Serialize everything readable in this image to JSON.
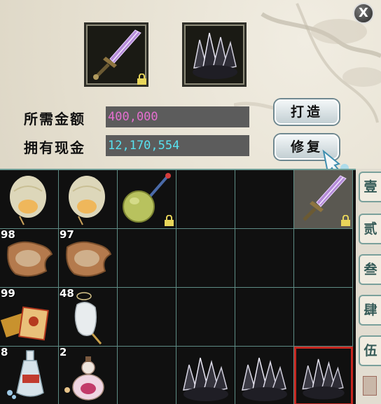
{
  "window": {
    "close_label": "X"
  },
  "forge": {
    "required_label": "所需金额",
    "required_value": "400,000",
    "owned_label": "拥有现金",
    "owned_value": "12,170,554",
    "craft_button": "打造",
    "repair_button": "修复",
    "slot_items": [
      "purple-sword-icon",
      "dark-ore-crystal-icon"
    ]
  },
  "colors": {
    "required": "#e56fd0",
    "owned": "#58e2f0",
    "selection": "#c6261f",
    "grid_line": "#5e8c85"
  },
  "inventory": {
    "rows": [
      [
        {
          "icon": "sky-lantern-icon",
          "count": ""
        },
        {
          "icon": "sky-lantern-icon",
          "count": ""
        },
        {
          "icon": "green-melon-hammer-icon",
          "count": "",
          "locked": true
        },
        {
          "icon": "",
          "count": ""
        },
        {
          "icon": "",
          "count": ""
        },
        {
          "icon": "purple-sword-icon",
          "count": "",
          "locked": true
        }
      ],
      [
        {
          "icon": "treasure-map-scroll-icon",
          "count": "98"
        },
        {
          "icon": "treasure-map-scroll-icon",
          "count": "97"
        },
        {
          "icon": "",
          "count": ""
        },
        {
          "icon": "",
          "count": ""
        },
        {
          "icon": "",
          "count": ""
        },
        {
          "icon": "",
          "count": ""
        }
      ],
      [
        {
          "icon": "red-envelope-icon",
          "count": "99"
        },
        {
          "icon": "white-jade-icon",
          "count": "48"
        },
        {
          "icon": "",
          "count": ""
        },
        {
          "icon": "",
          "count": ""
        },
        {
          "icon": "",
          "count": ""
        },
        {
          "icon": "",
          "count": ""
        }
      ],
      [
        {
          "icon": "potion-bottle-icon",
          "count": "8"
        },
        {
          "icon": "gourd-potion-icon",
          "count": "2"
        },
        {
          "icon": "",
          "count": ""
        },
        {
          "icon": "dark-ore-crystal-icon",
          "count": ""
        },
        {
          "icon": "dark-ore-crystal-icon",
          "count": ""
        },
        {
          "icon": "dark-ore-crystal-icon",
          "count": "",
          "selected": true
        }
      ]
    ]
  },
  "tabs": [
    "壹",
    "贰",
    "叁",
    "肆",
    "伍"
  ]
}
